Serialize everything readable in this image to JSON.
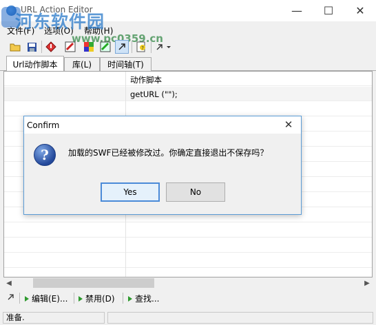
{
  "window": {
    "title": "URL Action Editor"
  },
  "watermark": {
    "text": "河东软件园",
    "url": "www.pc0359.cn"
  },
  "menu": {
    "items": [
      "文件(F)",
      "选项(O)",
      "帮助(H)"
    ]
  },
  "bottombar": {
    "edit_label": "编辑(E)...",
    "disable_label": "禁用(D)",
    "find_label": "查找..."
  },
  "tabs": [
    "Url动作脚本",
    "库(L)",
    "时间轴(T)"
  ],
  "grid": {
    "column_header": "动作脚本",
    "rows": [
      {
        "script": "getURL (\"\");"
      }
    ]
  },
  "status": {
    "text": "准备."
  },
  "dialog": {
    "title": "Confirm",
    "message": "加载的SWF已经被修改过。你确定直接退出不保存吗？",
    "yes_label": "Yes",
    "no_label": "No"
  }
}
